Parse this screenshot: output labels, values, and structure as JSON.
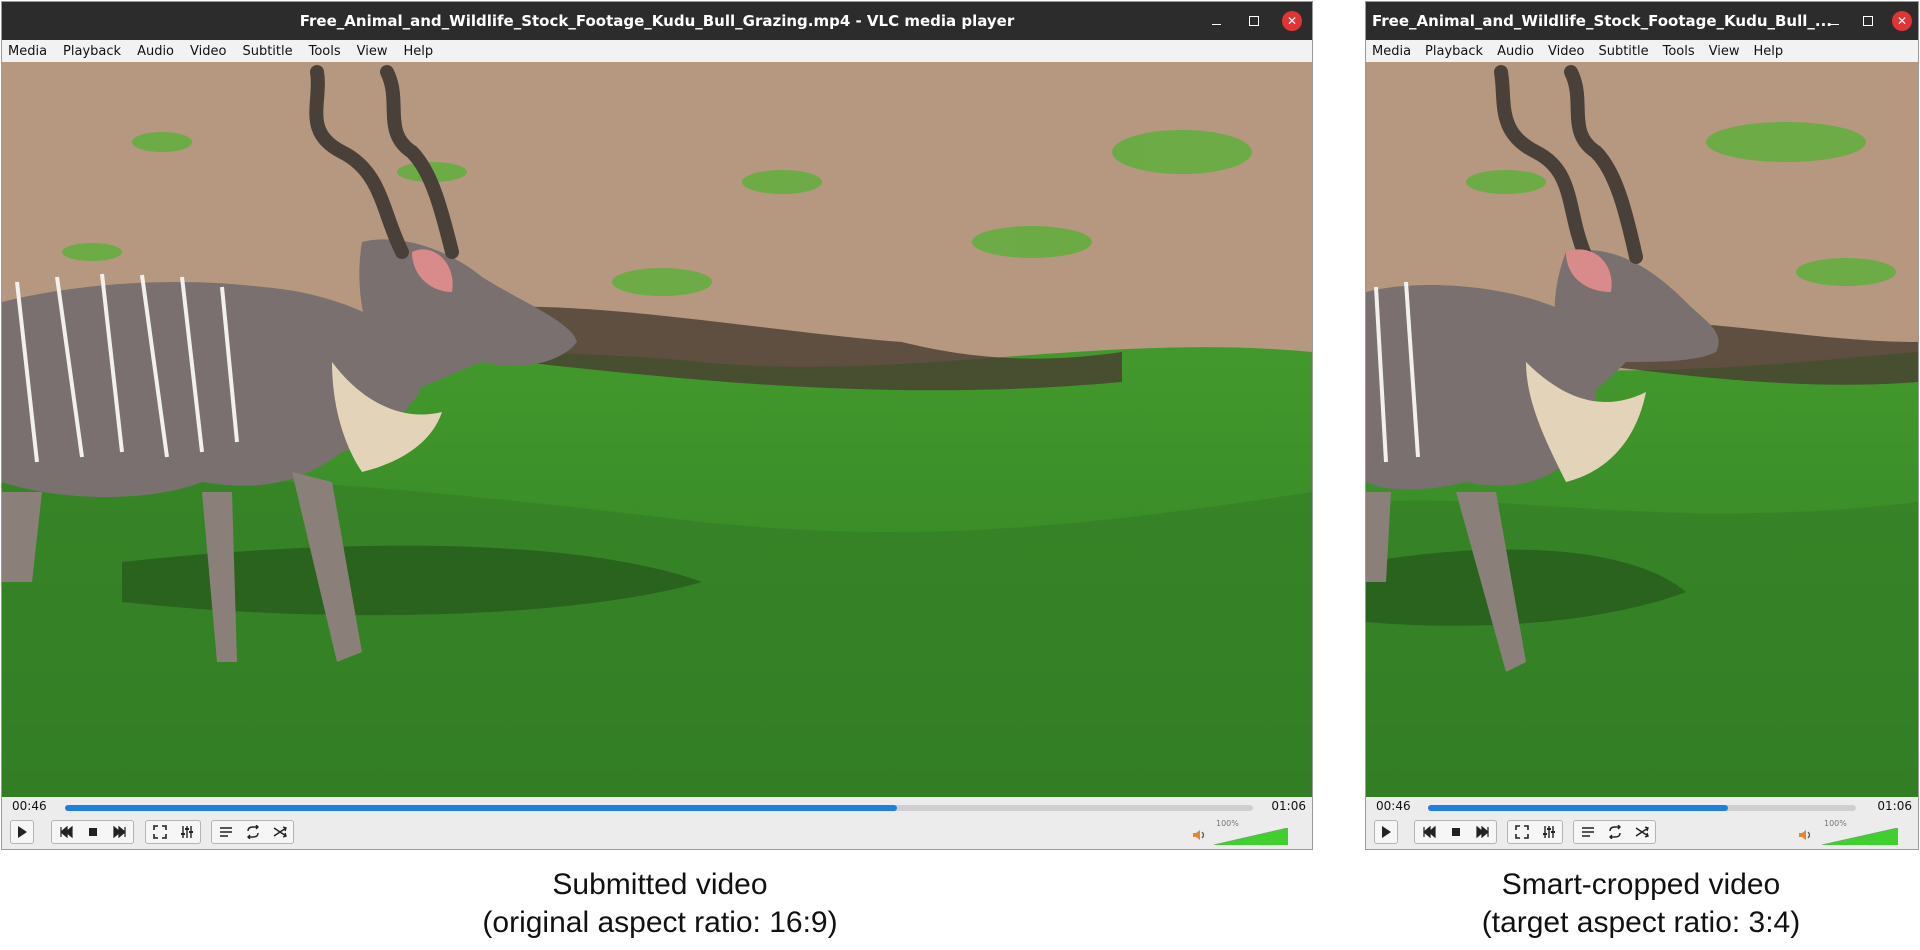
{
  "windows": [
    {
      "title": "Free_Animal_and_Wildlife_Stock_Footage_Kudu_Bull_Grazing.mp4 - VLC media player",
      "menu": [
        "Media",
        "Playback",
        "Audio",
        "Video",
        "Subtitle",
        "Tools",
        "View",
        "Help"
      ],
      "elapsed": "00:46",
      "total": "01:06",
      "progress": 0.7,
      "volume_label": "100%",
      "volume": 1.0
    },
    {
      "title": "Free_Animal_and_Wildlife_Stock_Footage_Kudu_Bull_...",
      "menu": [
        "Media",
        "Playback",
        "Audio",
        "Video",
        "Subtitle",
        "Tools",
        "View",
        "Help"
      ],
      "elapsed": "00:46",
      "total": "01:06",
      "progress": 0.7,
      "volume_label": "100%",
      "volume": 1.0
    }
  ],
  "captions": [
    {
      "line1": "Submitted video",
      "line2": "(original aspect ratio: 16:9)"
    },
    {
      "line1": "Smart-cropped video",
      "line2": "(target aspect ratio: 3:4)"
    }
  ],
  "colors": {
    "title_bar": "#2c2c2c",
    "close_button": "#e03535",
    "seek_fill": "#1e7fe0",
    "volume_fill": "#3fcf2f",
    "grass": "#3d9a2a",
    "dirt": "#b5987f"
  },
  "icons": [
    "play-icon",
    "previous-icon",
    "stop-icon",
    "next-icon",
    "fullscreen-icon",
    "extended-settings-icon",
    "playlist-icon",
    "loop-icon",
    "shuffle-icon",
    "volume-icon"
  ]
}
